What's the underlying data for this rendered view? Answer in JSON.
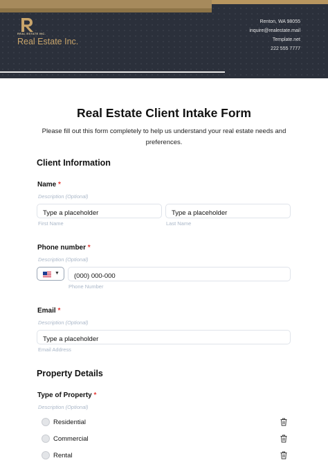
{
  "header": {
    "logo_small_text": "REAL ESTATE INC.",
    "brand_name": "Real Estate Inc.",
    "contact": {
      "address": "Renton, WA 98055",
      "email": "inquire@realestate.mail",
      "website": "Template.net",
      "phone": "222 555 7777"
    }
  },
  "form": {
    "title": "Real Estate Client Intake Form",
    "subtitle": "Please fill out this form completely to help us understand your real estate needs and preferences."
  },
  "client_information": {
    "heading": "Client Information",
    "name": {
      "label": "Name",
      "required_mark": "*",
      "description": "Description (Optional)",
      "first": {
        "value": "Type a placeholder",
        "hint": "First Name"
      },
      "last": {
        "value": "Type a placeholder",
        "hint": "Last Name"
      }
    },
    "phone": {
      "label": "Phone number",
      "required_mark": "*",
      "description": "Description (Optional)",
      "value": "(000) 000-000",
      "hint": "Phone Number",
      "country_icon": "us-flag-icon"
    },
    "email": {
      "label": "Email",
      "required_mark": "*",
      "description": "Description (Optional)",
      "value": "Type a placeholder",
      "hint": "Email Address"
    }
  },
  "property_details": {
    "heading": "Property Details",
    "type": {
      "label": "Type of Property",
      "required_mark": "*",
      "description": "Description (Optional)",
      "options": [
        "Residential",
        "Commercial",
        "Rental"
      ]
    }
  },
  "colors": {
    "banner": "#2b303b",
    "gold": "#a68a5c",
    "required": "#e53935",
    "hint": "#aab7c8"
  }
}
